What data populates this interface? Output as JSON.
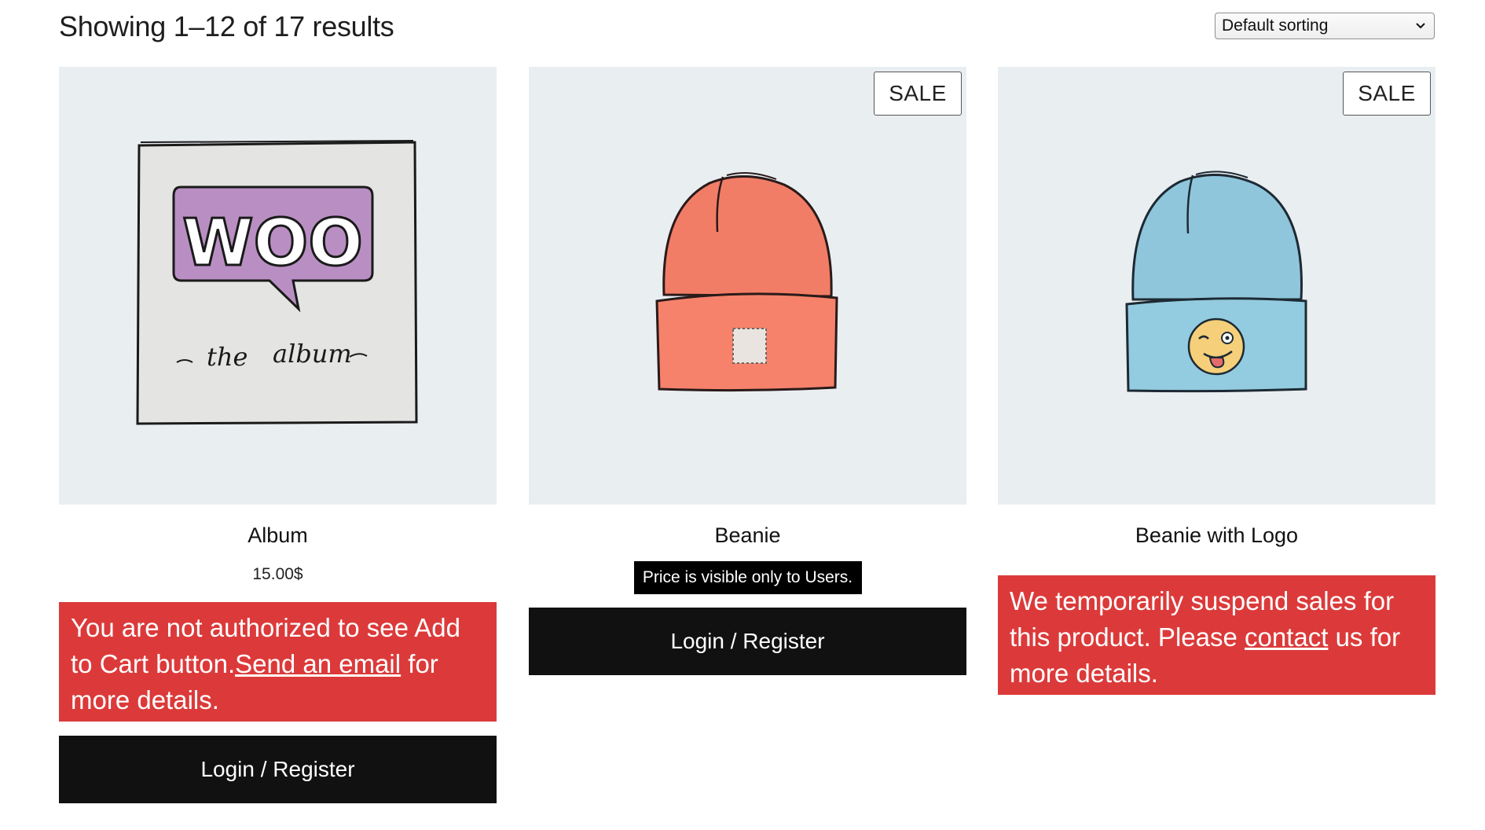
{
  "toolbar": {
    "result_count": "Showing 1–12 of 17 results",
    "sort_select_value": "Default sorting"
  },
  "products": [
    {
      "title": "Album",
      "price": "15.00$",
      "notice_pre": "You are not authorized to see Add to Cart button.",
      "notice_link": "Send an email",
      "notice_post": " for more details.",
      "button_label": "Login / Register",
      "image_text_main": "WOO",
      "image_text_sub1": "the",
      "image_text_sub2": "album"
    },
    {
      "title": "Beanie",
      "badge": "SALE",
      "price_note": "Price is visible only to Users.",
      "button_label": "Login / Register"
    },
    {
      "title": "Beanie with Logo",
      "badge": "SALE",
      "notice_pre": "We temporarily suspend sales for this product. Please ",
      "notice_link": "contact",
      "notice_post": " us for more details."
    }
  ],
  "colors": {
    "notice_red": "#dc3a3a",
    "button_black": "#111111",
    "image_bg": "#e9eef1",
    "beanie_orange": "#f27d66",
    "beanie_blue": "#8fc6dc",
    "woo_purple": "#b98fc3"
  }
}
